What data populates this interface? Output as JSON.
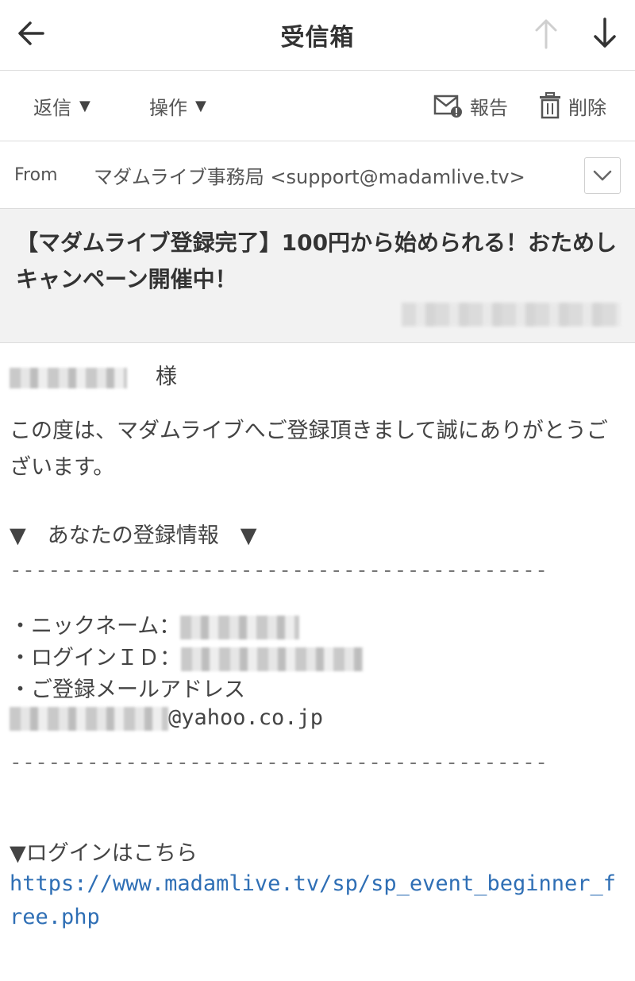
{
  "header": {
    "title": "受信箱"
  },
  "toolbar": {
    "reply_label": "返信",
    "action_label": "操作",
    "report_label": "報告",
    "delete_label": "削除",
    "caret": "▼"
  },
  "from": {
    "label": "From",
    "value": "マダムライブ事務局 <support@madamlive.tv>"
  },
  "subject": {
    "text": "【マダムライブ登録完了】100円から始められる！おためしキャンペーン開催中！"
  },
  "body": {
    "salutation_suffix": "様",
    "greeting": "この度は、マダムライブへご登録頂きまして誠にありがとうございます。",
    "section_title": "▼　あなたの登録情報　▼",
    "divider": "------------------------------------------",
    "nickname_label": "・ニックネーム：",
    "login_id_label": "・ログインＩＤ：",
    "email_label": "・ご登録メールアドレス",
    "email_domain": "@yahoo.co.jp",
    "login_heading": "▼ログインはこちら",
    "login_url": "https://www.madamlive.tv/sp/sp_event_beginner_free.php"
  }
}
